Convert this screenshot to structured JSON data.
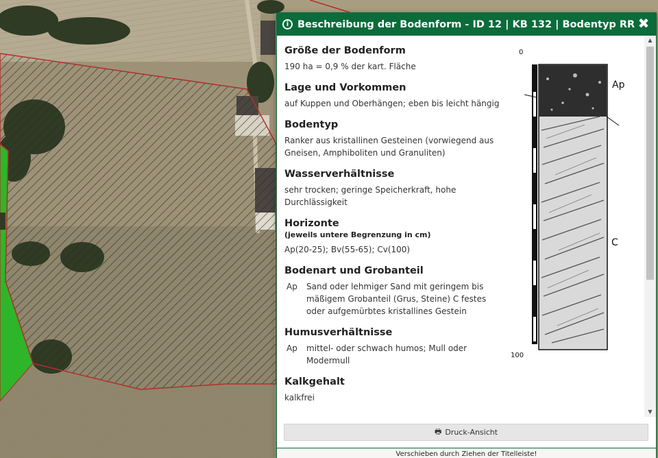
{
  "panel": {
    "title": "Beschreibung der Bodenform - ID 12 | KB 132 | Bodentyp RR",
    "close_label": "✖",
    "print_label": "Druck-Ansicht",
    "footer": "Verschieben durch Ziehen der Titelleiste!"
  },
  "sections": {
    "groesse": {
      "heading": "Größe der Bodenform",
      "text": "190 ha = 0,9 % der kart. Fläche"
    },
    "lage": {
      "heading": "Lage und Vorkommen",
      "text": "auf Kuppen und Oberhängen; eben bis leicht hängig"
    },
    "bodentyp": {
      "heading": "Bodentyp",
      "text": "Ranker aus kristallinen Gesteinen (vorwiegend aus Gneisen, Amphiboliten und Granuliten)"
    },
    "wasser": {
      "heading": "Wasserverhältnisse",
      "text": "sehr trocken; geringe Speicherkraft, hohe Durchlässigkeit"
    },
    "horizonte": {
      "heading": "Horizonte",
      "sub": "(jeweils untere Begrenzung in cm)",
      "text": "Ap(20-25); Bv(55-65); Cv(100)"
    },
    "bodenart": {
      "heading": "Bodenart und Grobanteil",
      "key": "Ap",
      "text": "Sand oder lehmiger Sand mit geringem bis mäßigem Grobanteil (Grus, Steine) C festes oder aufgemürbtes kristallines Gestein"
    },
    "humus": {
      "heading": "Humusverhältnisse",
      "key": "Ap",
      "text": "mittel- oder schwach humos; Mull oder Modermull"
    },
    "kalk": {
      "heading": "Kalkgehalt",
      "text": "kalkfrei"
    }
  },
  "profile": {
    "top_label": "0",
    "bottom_label": "100",
    "label_ap": "Ap",
    "label_c": "C"
  },
  "colors": {
    "accent": "#0b6b3a",
    "hatch_outline": "#b0302a",
    "green_area": "#2fb52a"
  }
}
